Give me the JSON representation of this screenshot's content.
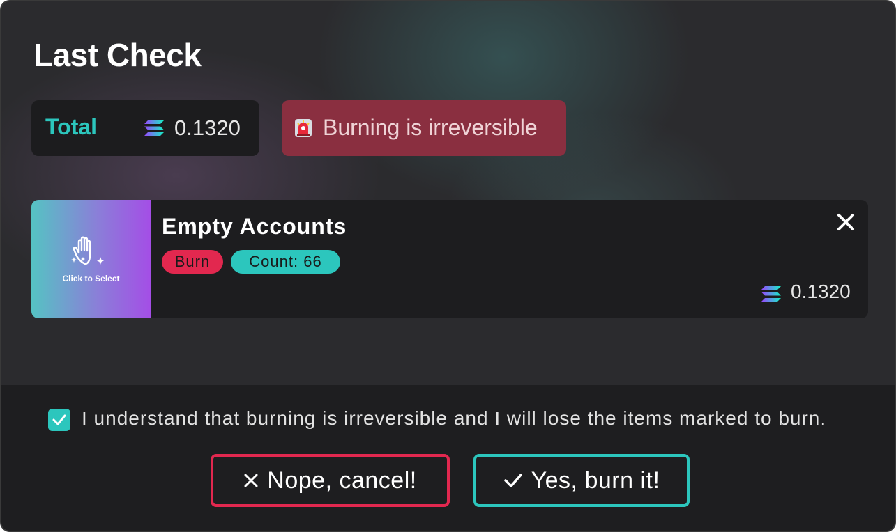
{
  "dialog": {
    "title": "Last Check"
  },
  "summary": {
    "total_label": "Total",
    "total_value": "0.1320",
    "currency_icon": "solana-icon",
    "warning_icon": "siren-icon",
    "warning_text": "Burning is irreversible"
  },
  "item": {
    "thumbnail_icon": "hand-sparkle-icon",
    "thumbnail_label": "Click to Select",
    "name": "Empty Accounts",
    "tags": [
      {
        "label": "Burn",
        "color": "#e2284f"
      },
      {
        "label": "Count: 66",
        "color": "#2cc6bd"
      }
    ],
    "value": "0.1320"
  },
  "consent": {
    "checked": true,
    "text": "I understand that burning is irreversible and I will lose the items marked to burn."
  },
  "actions": {
    "cancel_label": "Nope, cancel!",
    "confirm_label": "Yes, burn it!"
  },
  "colors": {
    "accent_teal": "#2cc6bd",
    "danger_red": "#e2284f",
    "warning_bg": "#8a2f40"
  }
}
